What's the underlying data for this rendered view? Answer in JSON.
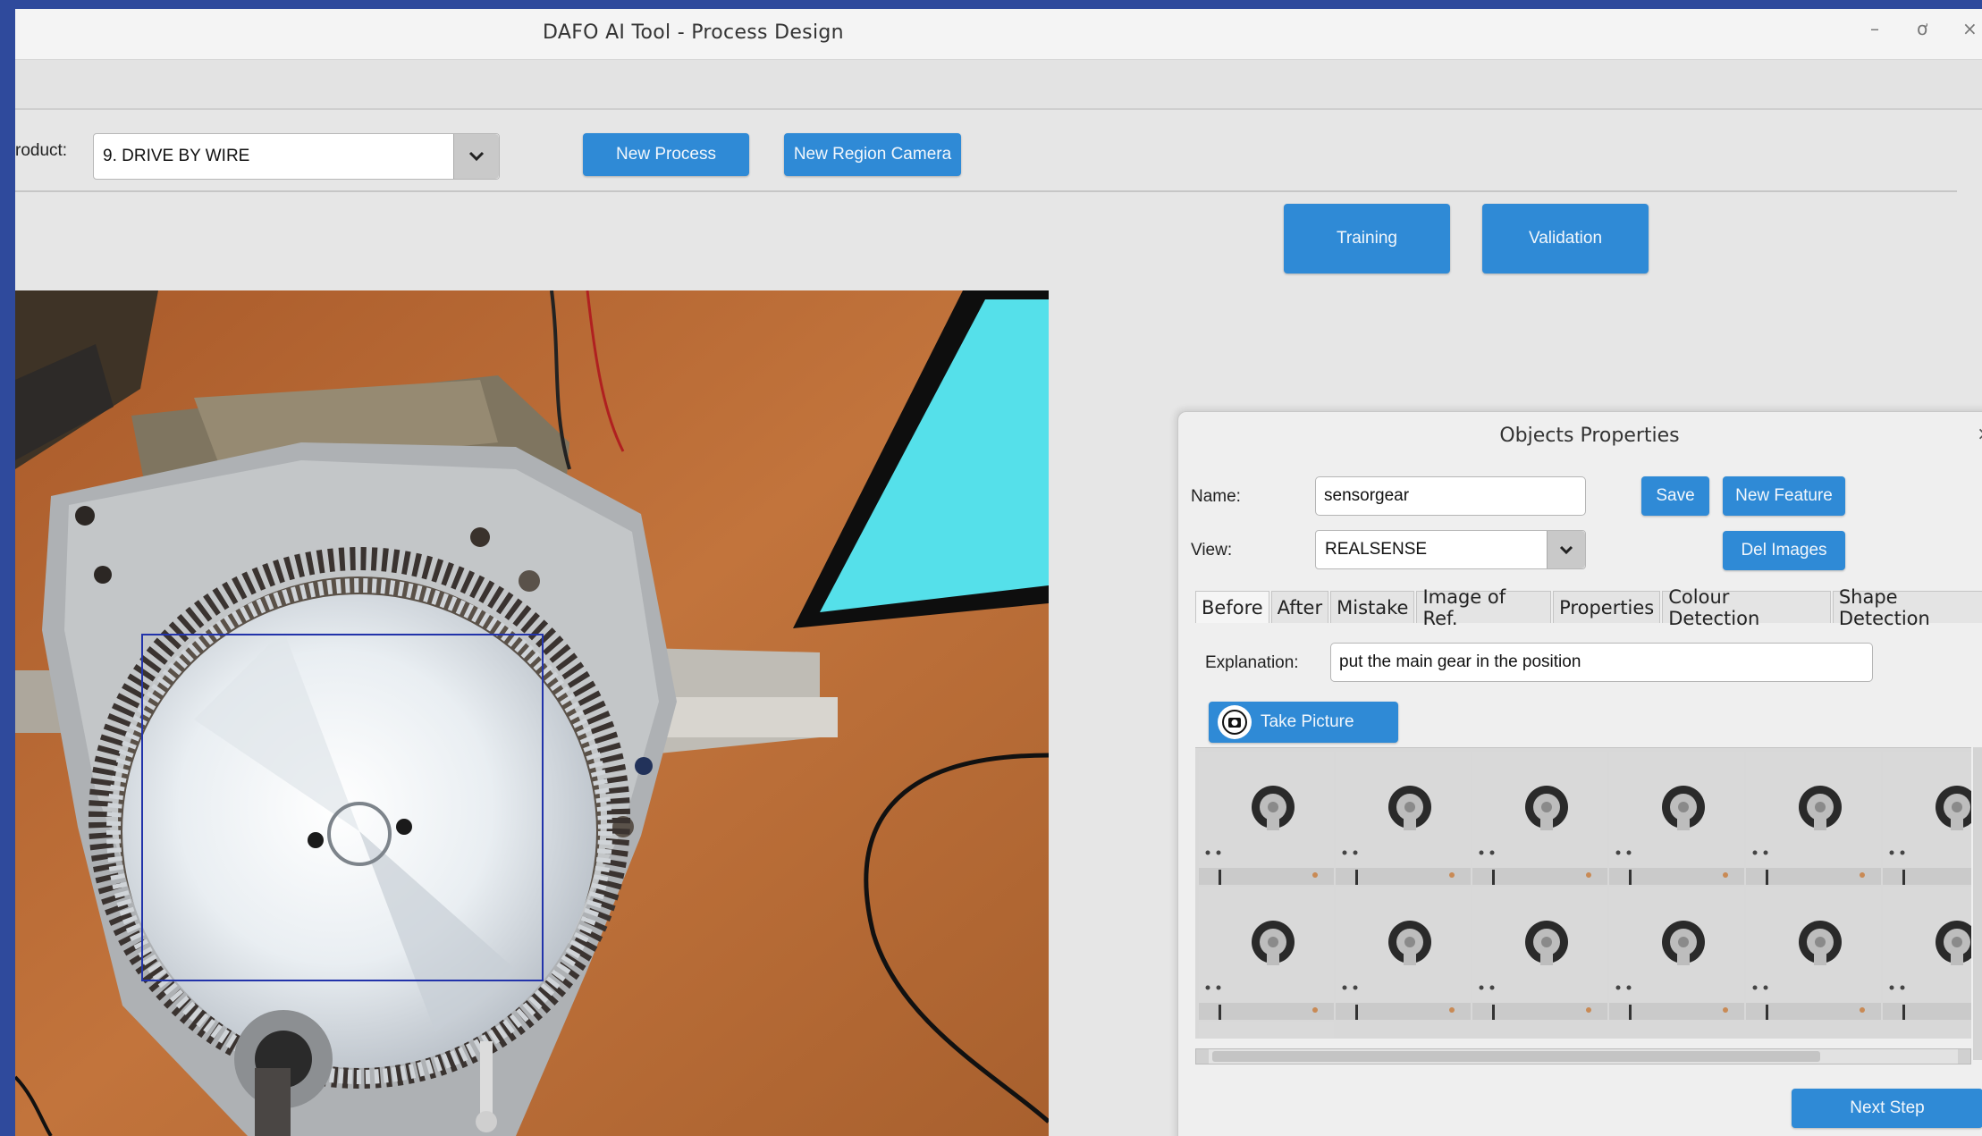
{
  "window": {
    "title": "DAFO AI Tool - Process Design",
    "controls": {
      "minimize": "–",
      "maximize": "ơ",
      "close": "×"
    }
  },
  "toolbar": {
    "product_label": "roduct:",
    "product_value": "9. DRIVE BY WIRE",
    "new_process_label": "New Process",
    "new_region_camera_label": "New Region Camera",
    "training_label": "Training",
    "validation_label": "Validation"
  },
  "dialog": {
    "title": "Objects Properties",
    "close": "×",
    "name_label": "Name:",
    "name_value": "sensorgear",
    "view_label": "View:",
    "view_value": "REALSENSE",
    "save_label": "Save",
    "new_feature_label": "New Feature",
    "del_images_label": "Del Images",
    "tabs": [
      "Before",
      "After",
      "Mistake",
      "Image of Ref.",
      "Properties",
      "Colour Detection",
      "Shape Detection"
    ],
    "active_tab": "Before",
    "explanation_label": "Explanation:",
    "explanation_value": "put the main gear in the position",
    "take_picture_label": "Take Picture",
    "next_step_label": "Next Step"
  },
  "colors": {
    "accent": "#2f8ad6",
    "background": "#e6e6e6",
    "frame": "#2f4a9c",
    "selection_box": "#2233aa"
  }
}
